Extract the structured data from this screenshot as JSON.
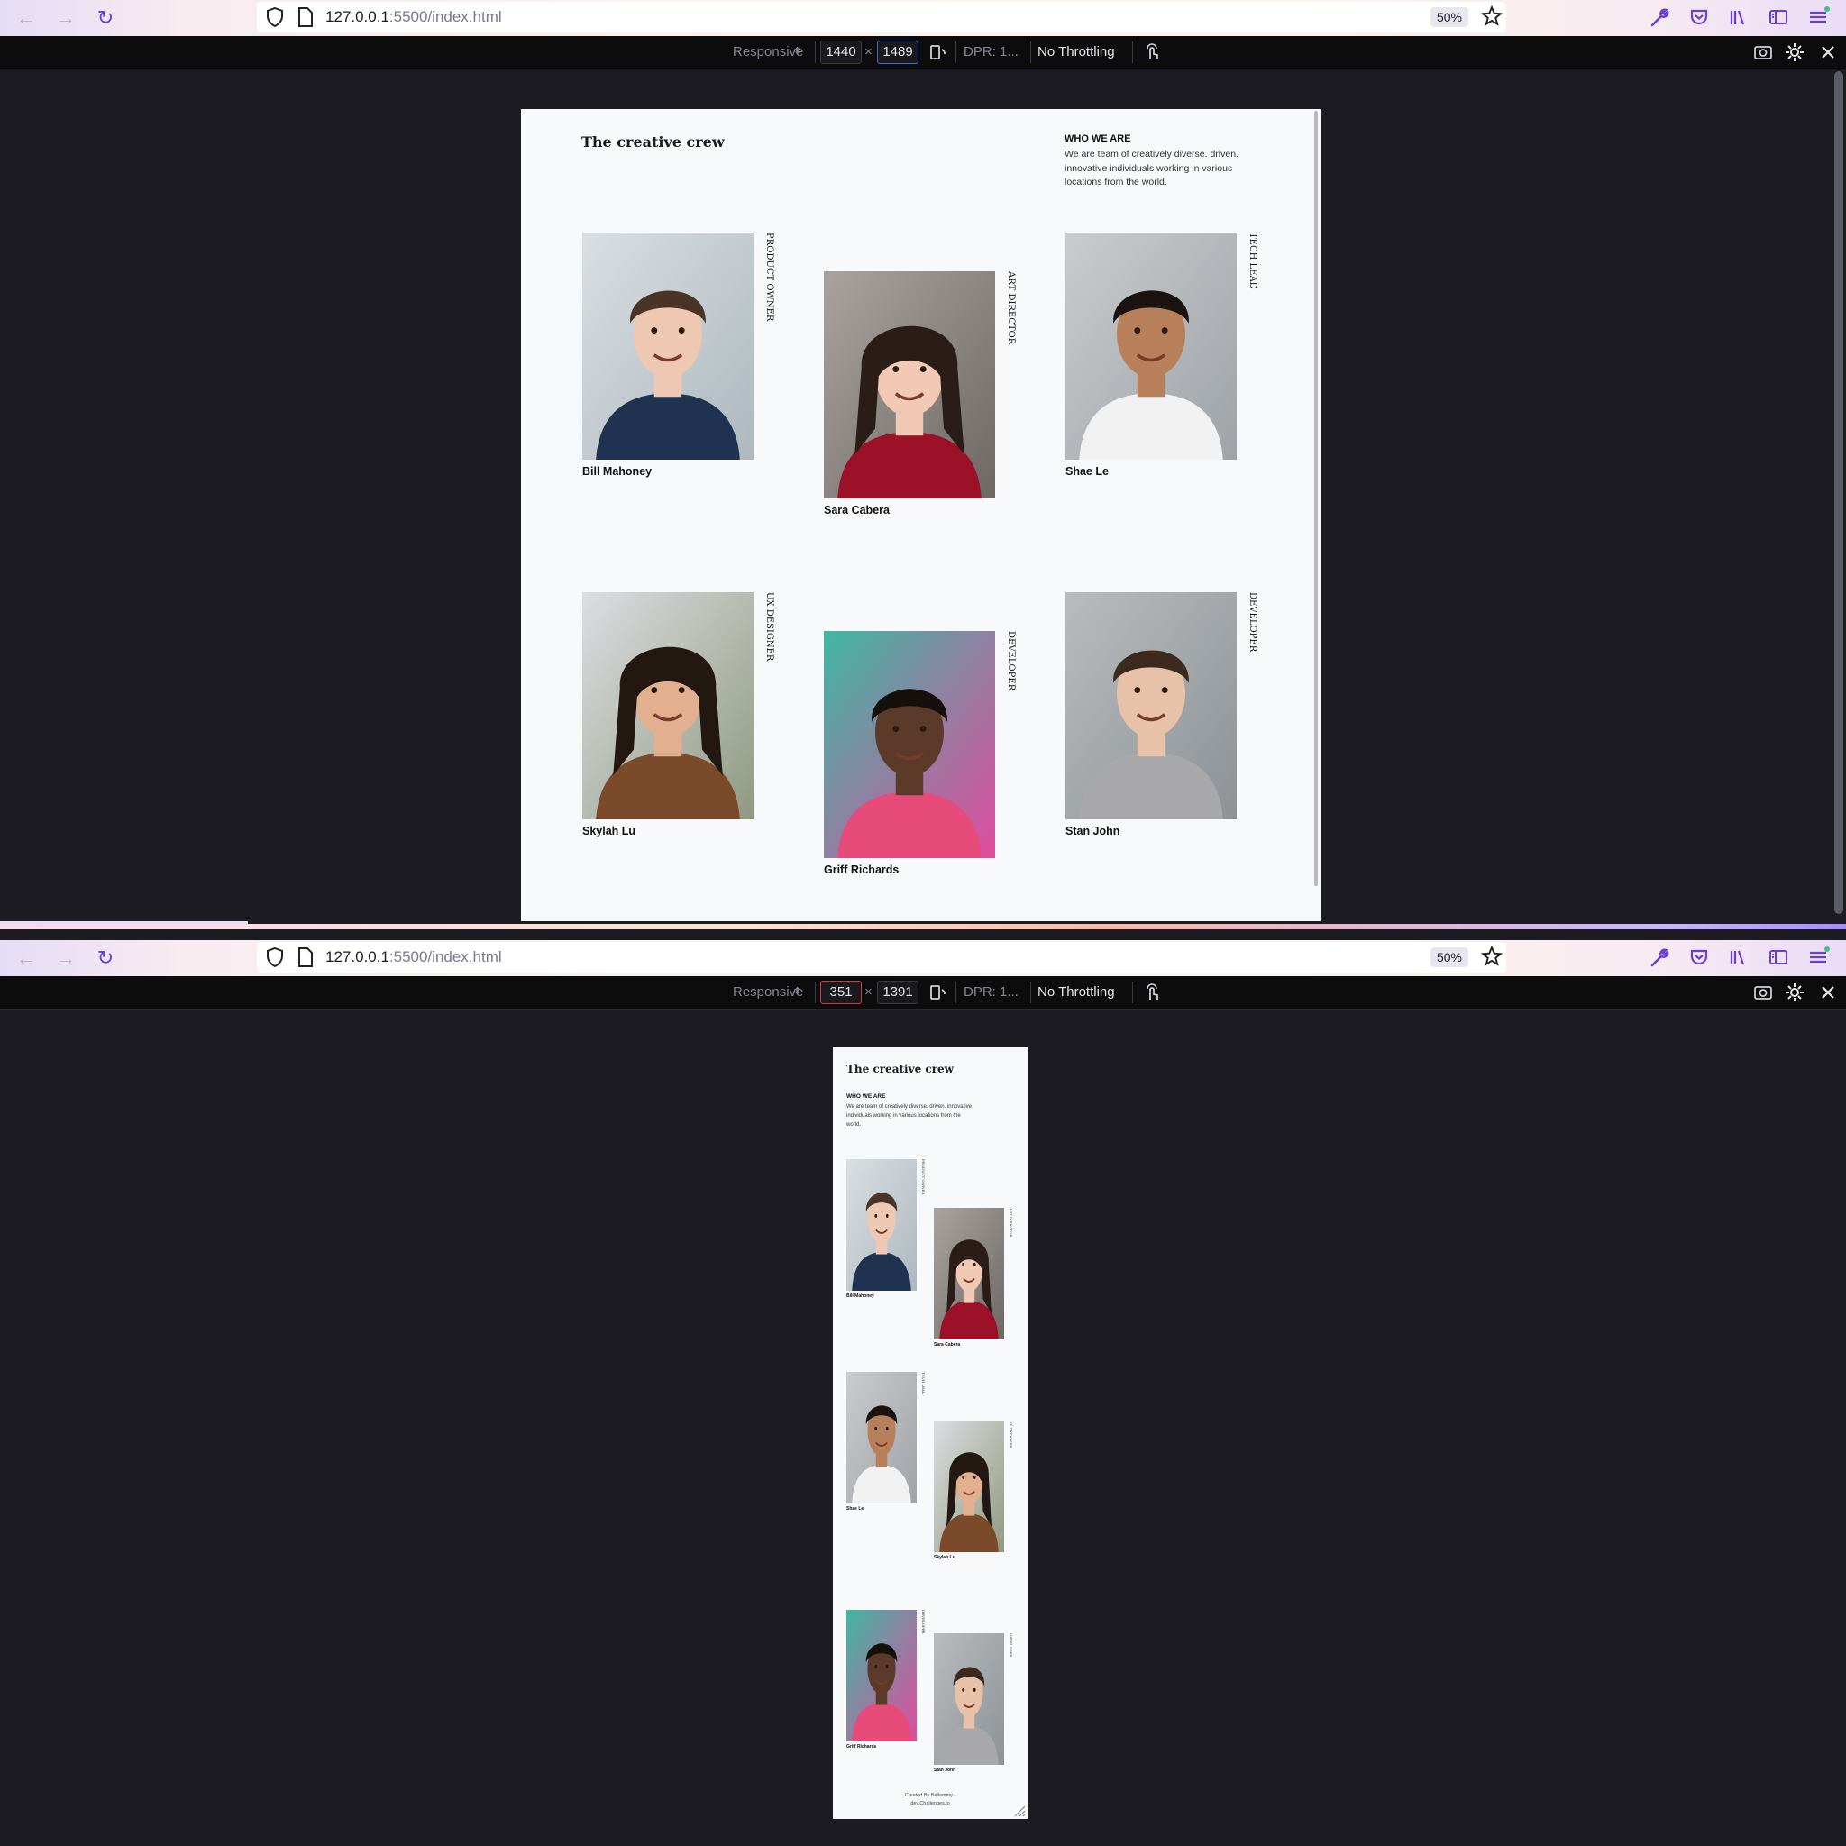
{
  "browser": {
    "url_host": "127.0.0.1",
    "url_rest": ":5500/index.html",
    "zoom": "50%",
    "device_mode": "Responsive",
    "dpr": "DPR: 1...",
    "throttling": "No Throttling",
    "times": "×"
  },
  "window1": {
    "width": "1440",
    "height": "1489"
  },
  "window2": {
    "width": "351",
    "height": "1391"
  },
  "page": {
    "title": "The creative crew",
    "who_heading": "WHO WE ARE",
    "who_text": "We are team of creatively diverse. driven. innovative individuals working in various locations from the world.",
    "footer_line1": "Created By Ballammy -",
    "footer_line2": "dev.Challenges.io"
  },
  "team": [
    {
      "name": "Bill Mahoney",
      "role": "PRODUCT OWNER"
    },
    {
      "name": "Sara Cabera",
      "role": "ART DIRECTOR"
    },
    {
      "name": "Shae Le",
      "role": "TECH LEAD"
    },
    {
      "name": "Skylah Lu",
      "role": "UX DESIGNER"
    },
    {
      "name": "Griff Richards",
      "role": "DEVELOPER"
    },
    {
      "name": "Stan John",
      "role": "DEVELOPER"
    }
  ],
  "icons": [
    "back-arrow-icon",
    "forward-arrow-icon",
    "reload-icon",
    "shield-icon",
    "page-icon",
    "star-icon",
    "wrench-icon",
    "pocket-icon",
    "library-icon",
    "sidebar-icon",
    "menu-icon",
    "rotate-icon",
    "touch-icon",
    "screenshot-icon",
    "settings-icon",
    "close-icon"
  ],
  "colors": {
    "accent": "#8a4dff",
    "page_bg": "#f7f9fa",
    "devtools_bg": "#1c1b22"
  }
}
